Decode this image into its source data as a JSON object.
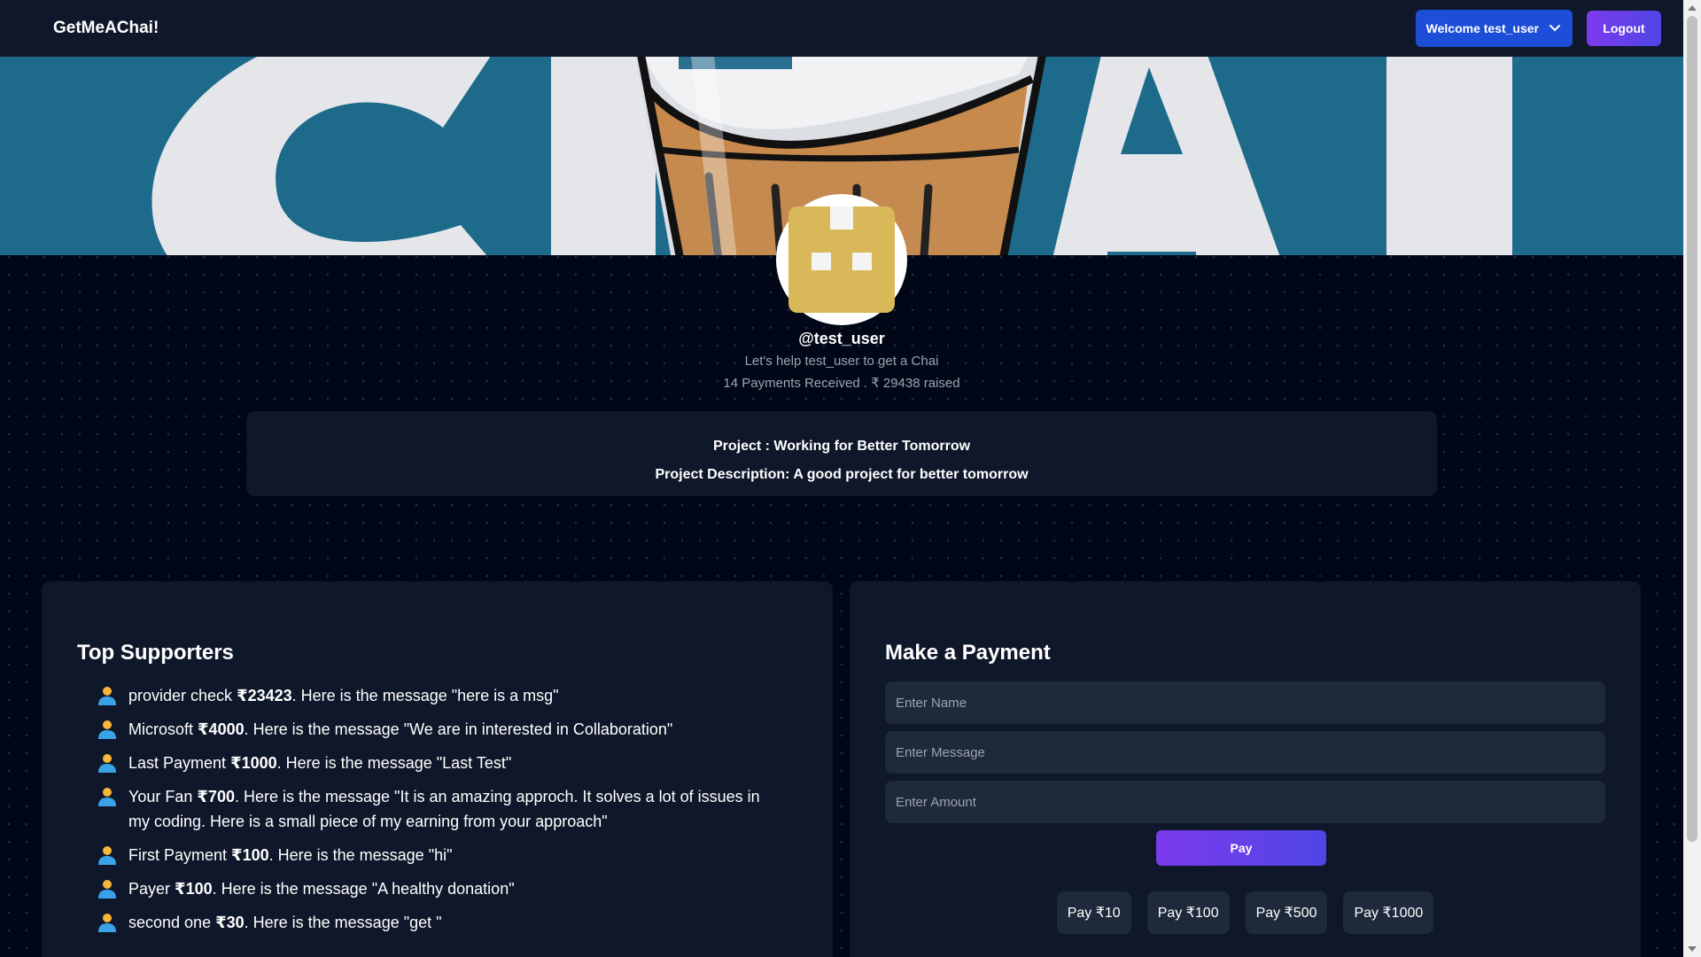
{
  "nav": {
    "brand": "GetMeAChai!",
    "welcome_label": "Welcome test_user",
    "logout_label": "Logout"
  },
  "profile": {
    "username": "@test_user",
    "tagline": "Let's help test_user to get a Chai",
    "stats": "14 Payments Received . ₹ 29438 raised"
  },
  "project": {
    "title": "Project : Working for Better Tomorrow",
    "description": "Project Description: A good project for better tomorrow"
  },
  "supporters": {
    "heading": "Top Supporters",
    "items": [
      {
        "name": "provider check",
        "amount": "₹23423",
        "suffix": ". Here is the message \"here is a msg\""
      },
      {
        "name": "Microsoft",
        "amount": "₹4000",
        "suffix": ". Here is the message \"We are in interested in Collaboration\""
      },
      {
        "name": "Last Payment",
        "amount": "₹1000",
        "suffix": ". Here is the message \"Last Test\""
      },
      {
        "name": "Your Fan",
        "amount": "₹700",
        "suffix": ". Here is the message \"It is an amazing approch. It solves a lot of issues in my coding. Here is a small piece of my earning from your approach\""
      },
      {
        "name": "First Payment",
        "amount": "₹100",
        "suffix": ". Here is the message \"hi\""
      },
      {
        "name": "Payer",
        "amount": "₹100",
        "suffix": ". Here is the message \"A healthy donation\""
      },
      {
        "name": "second one",
        "amount": "₹30",
        "suffix": ". Here is the message \"get \""
      }
    ]
  },
  "payment": {
    "heading": "Make a Payment",
    "name_placeholder": "Enter Name",
    "message_placeholder": "Enter Message",
    "amount_placeholder": "Enter Amount",
    "pay_label": "Pay",
    "quick": [
      "Pay ₹10",
      "Pay ₹100",
      "Pay ₹500",
      "Pay ₹1000"
    ]
  },
  "colors": {
    "page_bg": "#010717",
    "panel_bg": "#0f172a",
    "input_bg": "#1e293b",
    "accent_blue": "#1d4ed8",
    "accent_purple": "#7c3aed",
    "banner_teal": "#1d6a8a",
    "avatar_yellow": "#d9b85a"
  },
  "icons": {
    "supporter": "user-avatar-icon",
    "dropdown": "chevron-down-icon"
  }
}
